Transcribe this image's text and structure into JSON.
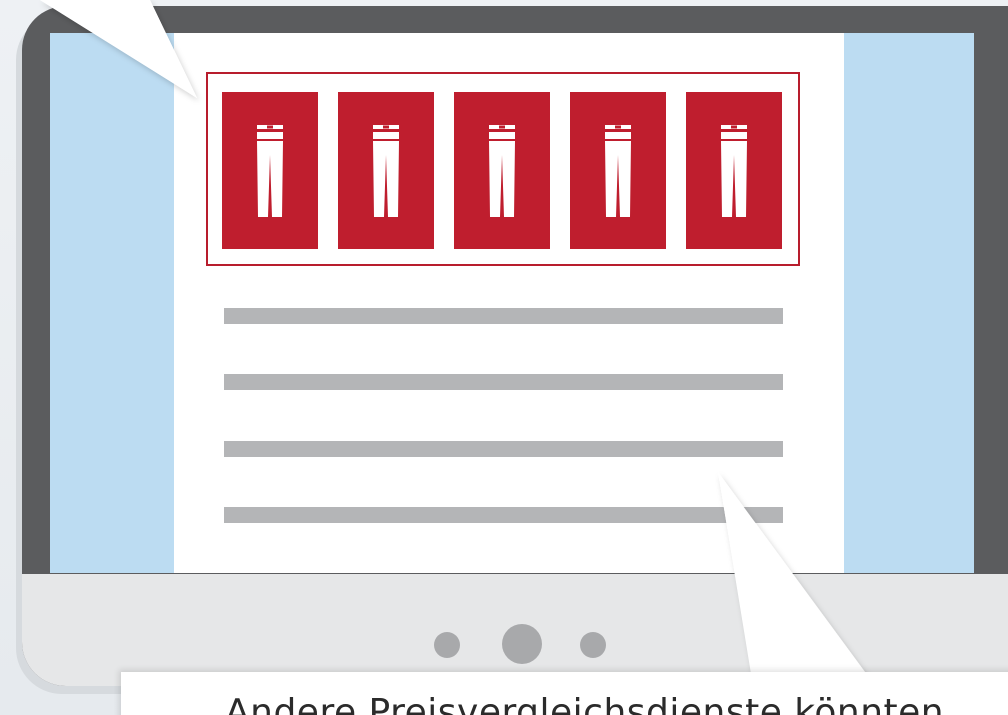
{
  "caption": {
    "text": "Andere Preisvergleichsdienste könnten"
  },
  "gallery": {
    "tile_color": "#bf1e2e",
    "frame_color": "#b81d2d",
    "tiles": [
      {
        "icon": "trousers-icon"
      },
      {
        "icon": "trousers-icon"
      },
      {
        "icon": "trousers-icon"
      },
      {
        "icon": "trousers-icon"
      },
      {
        "icon": "trousers-icon"
      }
    ]
  },
  "colors": {
    "monitor_bezel": "#5b5c5e",
    "monitor_chin": "#e6e7e8",
    "screen_side": "#bcdcf2",
    "page_background": "#ffffff",
    "placeholder_line": "#b4b5b7"
  },
  "placeholder_text_lines": 4,
  "chin_dots": 3
}
